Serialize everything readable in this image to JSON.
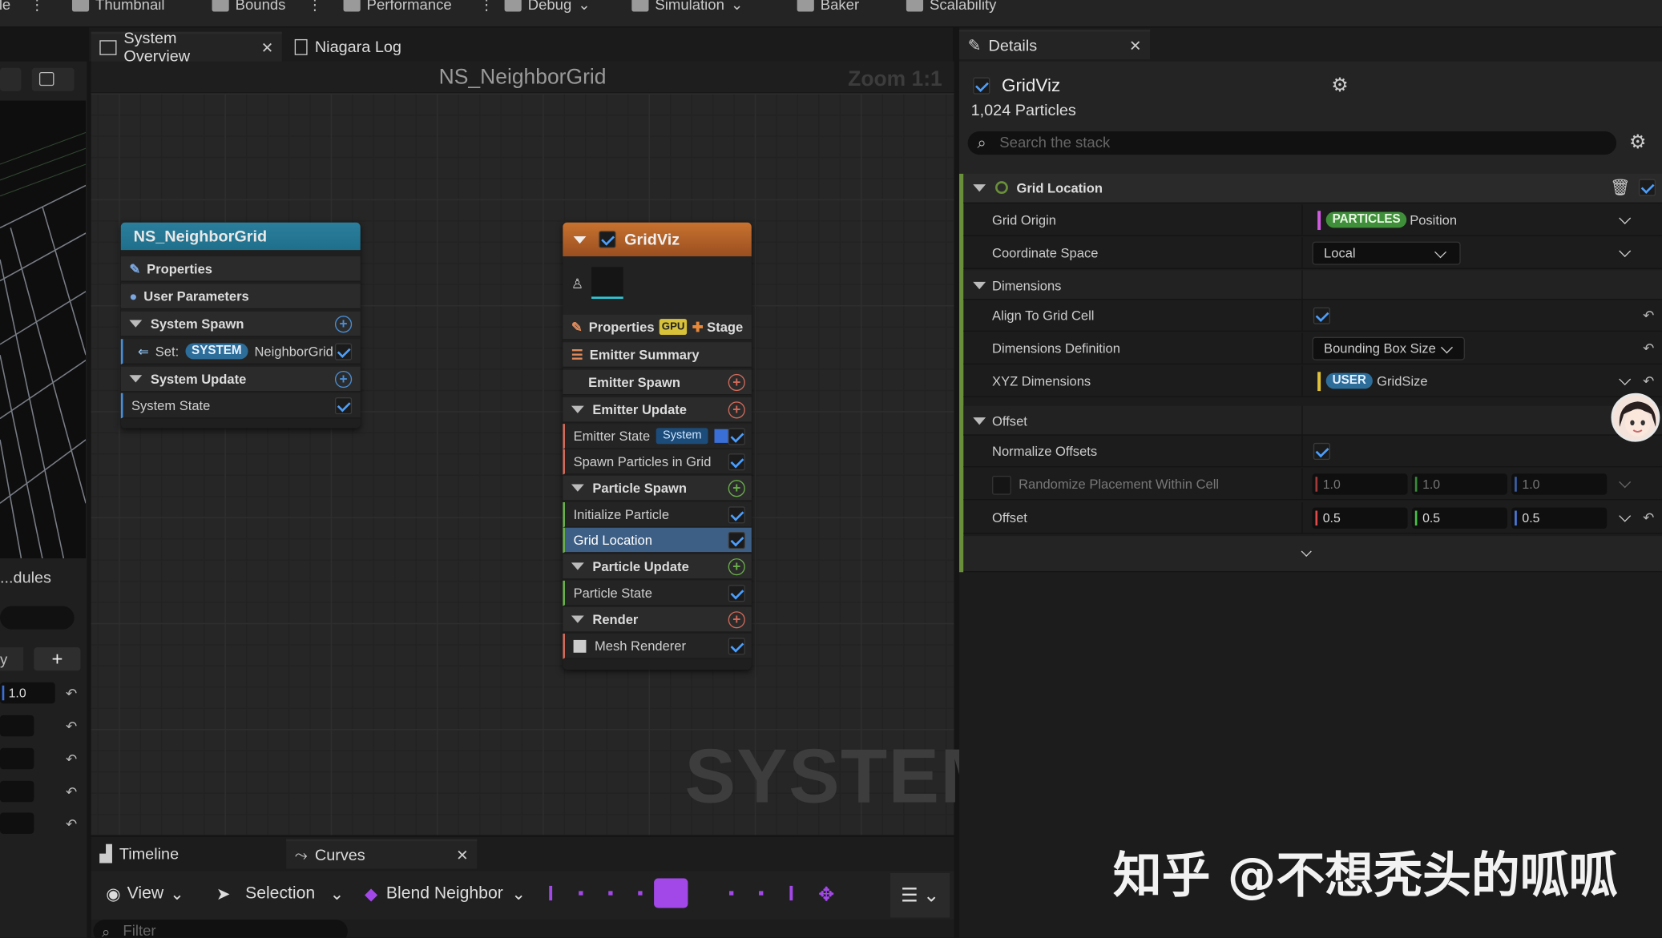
{
  "toolbar": {
    "items": [
      "ile",
      "Thumbnail",
      "Bounds",
      "Performance",
      "Debug",
      "Simulation",
      "Baker",
      "Scalability"
    ]
  },
  "tabs": {
    "system_overview": "System Overview",
    "niagara_log": "Niagara Log"
  },
  "graph": {
    "title": "NS_NeighborGrid",
    "zoom": "Zoom 1:1",
    "watermark": "SYSTEM"
  },
  "system_node": {
    "title": "NS_NeighborGrid",
    "properties": "Properties",
    "user_parameters": "User Parameters",
    "system_spawn": "System Spawn",
    "set_label": "Set:",
    "set_badge": "SYSTEM",
    "set_value": "NeighborGrid",
    "system_update": "System Update",
    "system_state": "System State"
  },
  "emitter_node": {
    "title": "GridViz",
    "properties": "Properties",
    "gpu_badge": "GPU",
    "stage": "Stage",
    "emitter_summary": "Emitter Summary",
    "emitter_spawn": "Emitter Spawn",
    "emitter_update": "Emitter Update",
    "emitter_state": "Emitter State",
    "emitter_state_badge": "System",
    "spawn_particles": "Spawn Particles in Grid",
    "particle_spawn": "Particle Spawn",
    "initialize_particle": "Initialize Particle",
    "grid_location": "Grid Location",
    "particle_update": "Particle Update",
    "particle_state": "Particle State",
    "render": "Render",
    "mesh_renderer": "Mesh Renderer"
  },
  "left_panel": {
    "modules_label": "...dules",
    "value": "1.0"
  },
  "details": {
    "tab": "Details",
    "emitter_name": "GridViz",
    "particles": "1,024 Particles",
    "search_placeholder": "Search the stack",
    "section": "Grid Location",
    "grid_origin_label": "Grid Origin",
    "grid_origin_badge": "PARTICLES",
    "grid_origin_value": "Position",
    "coord_space_label": "Coordinate Space",
    "coord_space_value": "Local",
    "dimensions": "Dimensions",
    "align_label": "Align To Grid Cell",
    "dim_def_label": "Dimensions Definition",
    "dim_def_value": "Bounding Box Size",
    "xyz_label": "XYZ Dimensions",
    "xyz_badge": "USER",
    "xyz_value": "GridSize",
    "offset_section": "Offset",
    "normalize_label": "Normalize Offsets",
    "randomize_label": "Randomize Placement Within Cell",
    "rand_x": "1.0",
    "rand_y": "1.0",
    "rand_z": "1.0",
    "offset_label": "Offset",
    "off_x": "0.5",
    "off_y": "0.5",
    "off_z": "0.5"
  },
  "bottom": {
    "timeline": "Timeline",
    "curves": "Curves",
    "view": "View",
    "selection": "Selection",
    "blend": "Blend Neighbor",
    "filter_placeholder": "Filter"
  },
  "overlay_watermark": "知乎 @不想秃头的呱呱",
  "colors": {
    "system_header": "#1f6f8b",
    "emitter_header": "#b8612a",
    "check_blue": "#4a9fff",
    "selected_row": "#3d5f86",
    "particles_badge": "#3f8f3a",
    "user_badge": "#2d6d9a",
    "timeline_purple": "#a348e8"
  }
}
